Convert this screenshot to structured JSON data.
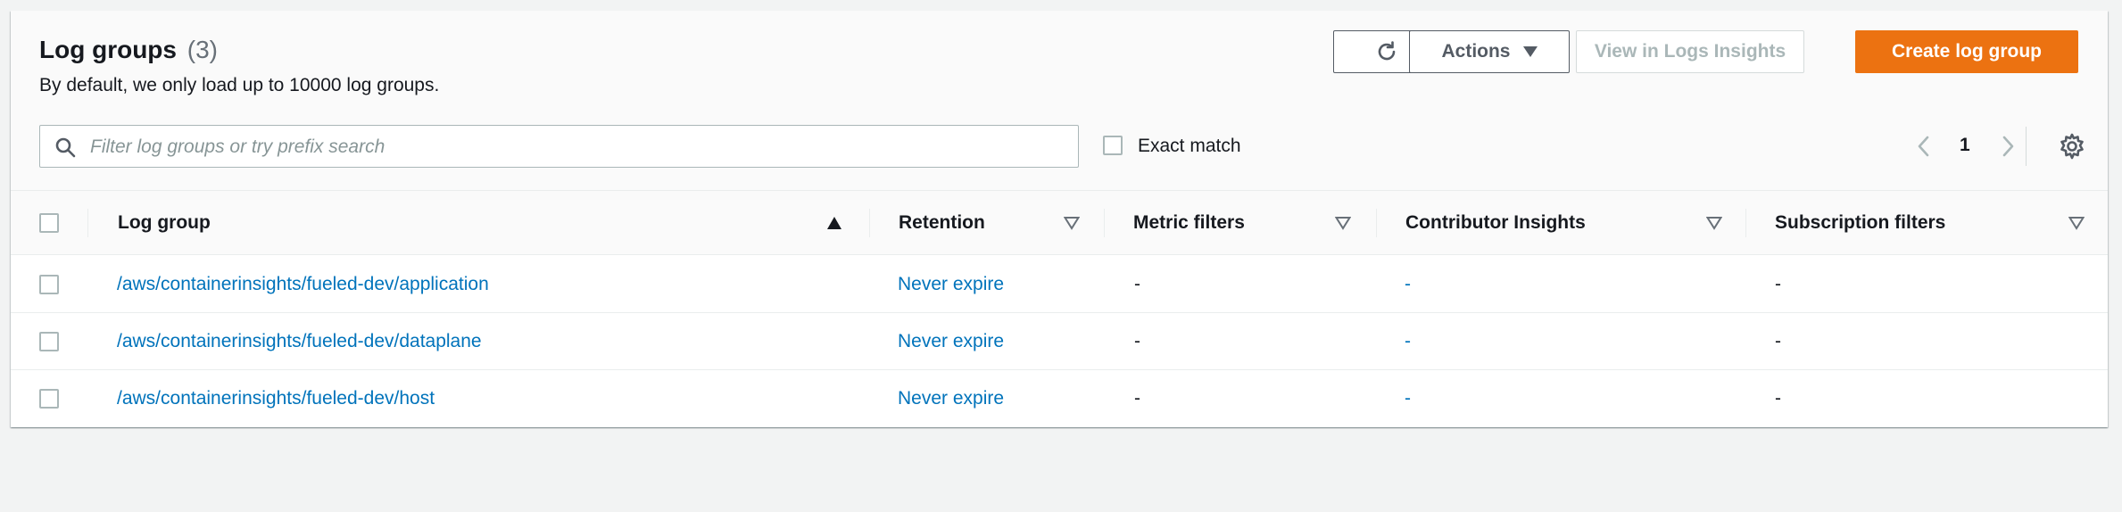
{
  "header": {
    "title": "Log groups",
    "count": "(3)",
    "description": "By default, we only load up to 10000 log groups."
  },
  "toolbar": {
    "actions_label": "Actions",
    "view_insights_label": "View in Logs Insights",
    "create_label": "Create log group"
  },
  "filter": {
    "placeholder": "Filter log groups or try prefix search",
    "exact_match_label": "Exact match"
  },
  "pagination": {
    "current_page": "1"
  },
  "table": {
    "columns": [
      "Log group",
      "Retention",
      "Metric filters",
      "Contributor Insights",
      "Subscription filters"
    ],
    "rows": [
      {
        "log_group": "/aws/containerinsights/fueled-dev/application",
        "retention": "Never expire",
        "metric_filters": "-",
        "contributor_insights": "-",
        "subscription_filters": "-"
      },
      {
        "log_group": "/aws/containerinsights/fueled-dev/dataplane",
        "retention": "Never expire",
        "metric_filters": "-",
        "contributor_insights": "-",
        "subscription_filters": "-"
      },
      {
        "log_group": "/aws/containerinsights/fueled-dev/host",
        "retention": "Never expire",
        "metric_filters": "-",
        "contributor_insights": "-",
        "subscription_filters": "-"
      }
    ]
  },
  "icons": {
    "refresh": "refresh-icon",
    "caret": "caret-down-icon",
    "search": "search-icon",
    "prev": "chevron-left-icon",
    "next": "chevron-right-icon",
    "settings": "gear-icon",
    "sort_asc": "sort-ascending-icon",
    "sort": "sort-icon"
  },
  "colors": {
    "primary": "#ec7211",
    "link": "#0073bb",
    "text": "#16191f",
    "muted": "#687078",
    "disabled": "#aab7b8"
  }
}
